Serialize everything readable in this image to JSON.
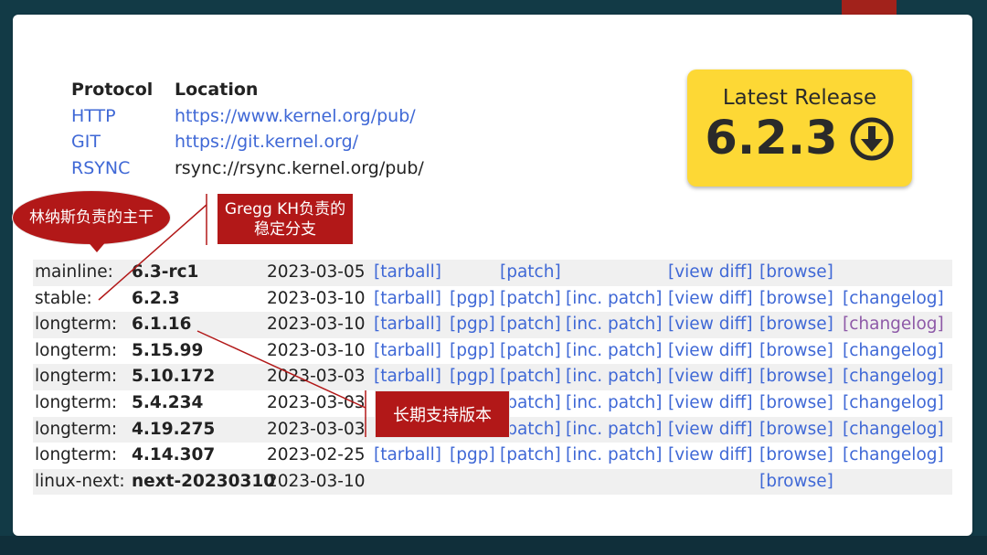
{
  "protocols": {
    "header": {
      "protocol": "Protocol",
      "location": "Location"
    },
    "rows": [
      {
        "protocol": "HTTP",
        "location": "https://www.kernel.org/pub/"
      },
      {
        "protocol": "GIT",
        "location": "https://git.kernel.org/"
      },
      {
        "protocol": "RSYNC",
        "location": "rsync://rsync.kernel.org/pub/"
      }
    ]
  },
  "latest_release": {
    "label": "Latest Release",
    "version": "6.2.3"
  },
  "links": {
    "tarball": "[tarball]",
    "pgp": "[pgp]",
    "patch": "[patch]",
    "inc_patch": "[inc. patch]",
    "view_diff": "[view diff]",
    "browse": "[browse]",
    "changelog": "[changelog]"
  },
  "releases": [
    {
      "kind": "mainline:",
      "version": "6.3-rc1",
      "date": "2023-03-05"
    },
    {
      "kind": "stable:",
      "version": "6.2.3",
      "date": "2023-03-10"
    },
    {
      "kind": "longterm:",
      "version": "6.1.16",
      "date": "2023-03-10"
    },
    {
      "kind": "longterm:",
      "version": "5.15.99",
      "date": "2023-03-10"
    },
    {
      "kind": "longterm:",
      "version": "5.10.172",
      "date": "2023-03-03"
    },
    {
      "kind": "longterm:",
      "version": "5.4.234",
      "date": "2023-03-03"
    },
    {
      "kind": "longterm:",
      "version": "4.19.275",
      "date": "2023-03-03"
    },
    {
      "kind": "longterm:",
      "version": "4.14.307",
      "date": "2023-02-25"
    },
    {
      "kind": "linux-next:",
      "version": "next-20230310",
      "date": "2023-03-10"
    }
  ],
  "annotations": {
    "linus": "林纳斯负责的主干",
    "gregg": "Gregg KH负责的稳定分支",
    "longterm": "长期支持版本"
  },
  "colors": {
    "accent_red": "#b21818",
    "link_blue": "#3f68d6",
    "release_yellow": "#fdd835"
  }
}
